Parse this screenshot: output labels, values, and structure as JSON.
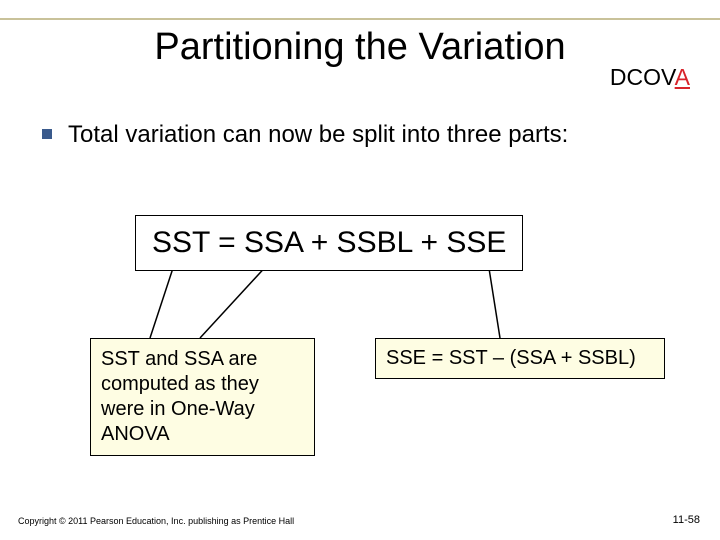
{
  "title": "Partitioning the Variation",
  "dcova": {
    "prefix": "DCOV",
    "highlight": "A"
  },
  "bullet": "Total variation can now be split into three parts:",
  "equation": "SST = SSA + SSBL + SSE",
  "note_left": "SST and SSA are computed as they were in One-Way ANOVA",
  "note_right": "SSE = SST – (SSA + SSBL)",
  "copyright": "Copyright © 2011 Pearson Education, Inc. publishing as Prentice Hall",
  "page_number": "11-58"
}
